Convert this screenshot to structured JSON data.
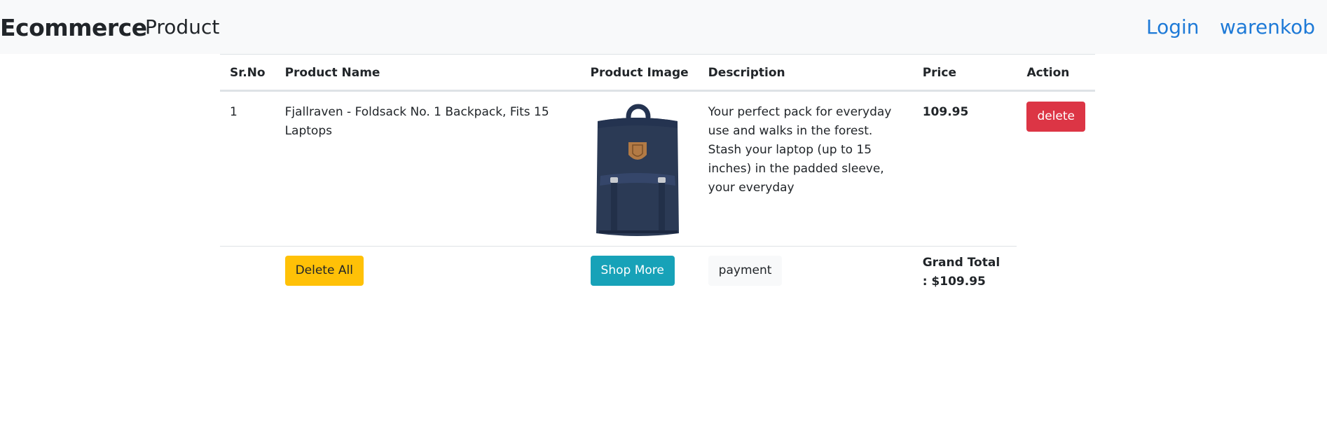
{
  "navbar": {
    "brand": "Ecommerce",
    "product_link": "Product",
    "login_link": "Login",
    "user_link": "warenkob"
  },
  "table": {
    "headers": [
      "Sr.No",
      "Product Name",
      "Product Image",
      "Description",
      "Price",
      "Action"
    ],
    "rows": [
      {
        "sr_no": "1",
        "name": "Fjallraven - Foldsack No. 1 Backpack, Fits 15 Laptops",
        "image_icon": "backpack-image",
        "description": "Your perfect pack for everyday use and walks in the forest. Stash your laptop (up to 15 inches) in the padded sleeve, your everyday",
        "price": "109.95",
        "action_label": "delete"
      }
    ],
    "footer": {
      "delete_all_label": "Delete All",
      "shop_more_label": "Shop More",
      "payment_label": "payment",
      "grand_total": "Grand Total : $109.95"
    }
  },
  "colors": {
    "navbar_bg": "#f8f9fa",
    "link": "#1e7ad7",
    "danger": "#dc3545",
    "warning": "#ffc107",
    "info": "#17a2b8",
    "light": "#f8f9fa",
    "backpack": "#2b3a55"
  }
}
